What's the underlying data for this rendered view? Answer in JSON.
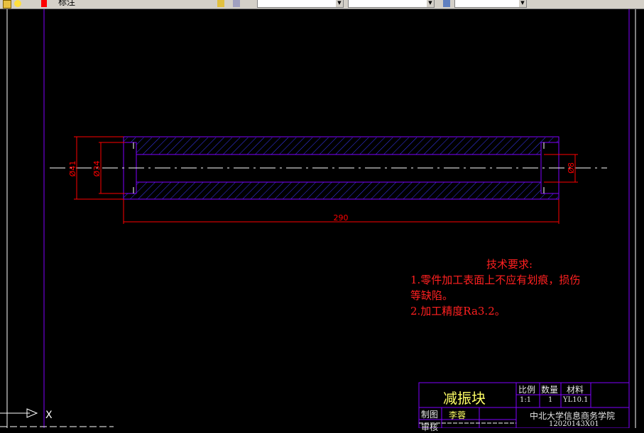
{
  "toolbar": {
    "layer_name": "标注",
    "icons": [
      "folder-icon",
      "sun-icon",
      "layer-color-icon",
      "layer-stack-icon",
      "color-icon",
      "linetype-icon",
      "lineweight-icon"
    ]
  },
  "drawing": {
    "dimensions": {
      "d1": "Ø41",
      "d2": "Ø34",
      "d3": "Ø8",
      "length": "290"
    },
    "tech_requirements": {
      "title": "技术要求:",
      "line1": "1.零件加工表面上不应有划痕，损伤",
      "line2": "等缺陷。",
      "line3": "2.加工精度Ra3.2。"
    },
    "title_block": {
      "part_name": "减振块",
      "scale_label": "比例",
      "qty_label": "数量",
      "material_label": "材料",
      "scale_value": "1:1",
      "qty_value": "1",
      "material_value": "YL10.1",
      "drawn_label": "制图",
      "drawn_by": "李蓉",
      "checked_label": "审核",
      "school": "中北大学信息商务学院",
      "student_id": "12020143X01"
    },
    "ucs_label": "X",
    "colors": {
      "background": "#000000",
      "outline": "#8000ff",
      "dimension": "#ff0000",
      "text": "#ff2020",
      "hatch": "#3a3aff",
      "centerline": "#ffffff",
      "title_text": "#ffff66"
    }
  }
}
